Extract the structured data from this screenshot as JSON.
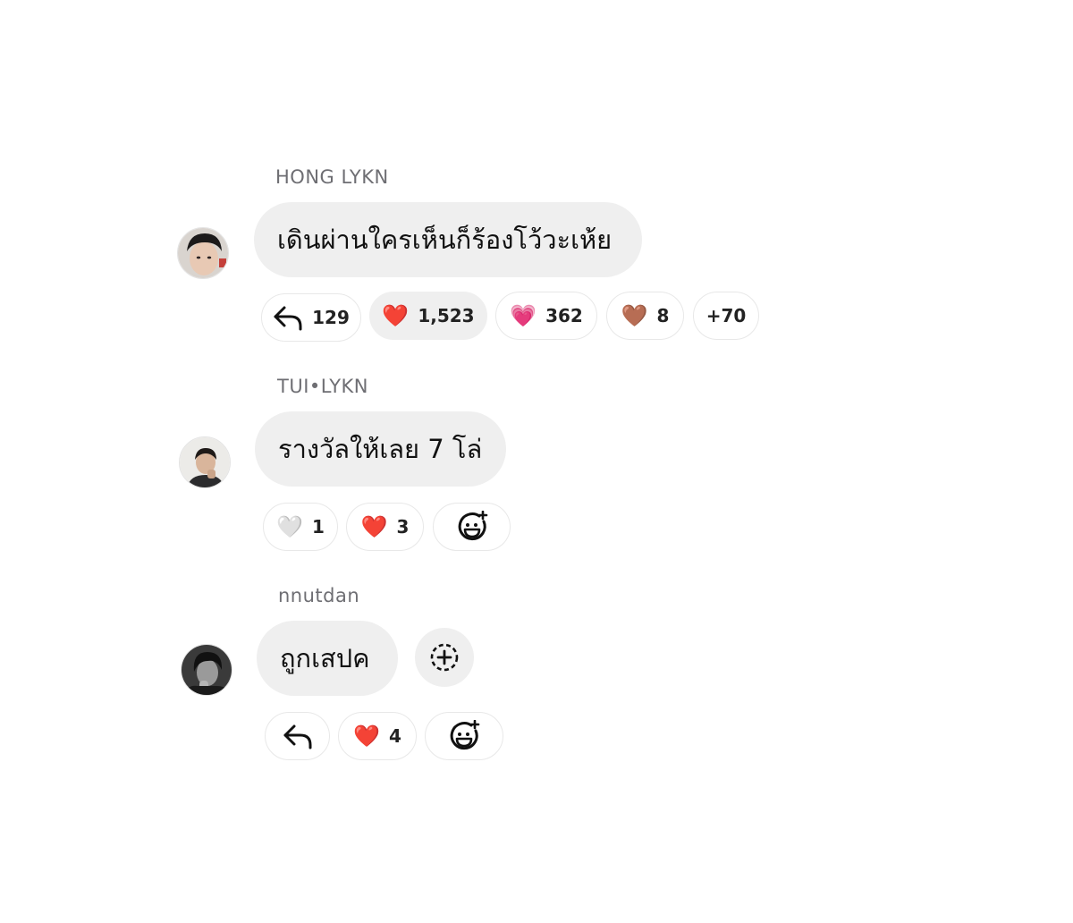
{
  "comments": [
    {
      "username": "HONG LYKN",
      "text": "เดินผ่านใครเห็นก็ร้องโว้วะเห้ย",
      "avatar_icon": "avatar-icon",
      "reactions": [
        {
          "icon": "reply-icon",
          "count": "129"
        },
        {
          "icon": "red-heart-icon",
          "glyph": "❤️",
          "count": "1,523",
          "active": true
        },
        {
          "icon": "pink-heart-icon",
          "glyph": "💗",
          "count": "362"
        },
        {
          "icon": "brown-heart-icon",
          "glyph": "🤎",
          "count": "8"
        },
        {
          "icon": "more-reactions",
          "count": "+70"
        }
      ]
    },
    {
      "username": "TUI•LYKN",
      "text": "รางวัลให้เลย 7 โล่",
      "avatar_icon": "avatar-icon",
      "reactions": [
        {
          "icon": "white-heart-icon",
          "glyph": "🤍",
          "count": "1"
        },
        {
          "icon": "red-heart-icon",
          "glyph": "❤️",
          "count": "3"
        },
        {
          "icon": "add-reaction-icon"
        }
      ]
    },
    {
      "username": "nnutdan",
      "text": "ถูกเสปค",
      "avatar_icon": "avatar-icon",
      "reactions": [
        {
          "icon": "reply-icon"
        },
        {
          "icon": "red-heart-icon",
          "glyph": "❤️",
          "count": "4"
        },
        {
          "icon": "add-reaction-icon"
        }
      ]
    }
  ],
  "colors": {
    "bubble": "#efefef",
    "username": "#6e6e73",
    "pill_border": "#e8e8e8",
    "text": "#111111"
  }
}
